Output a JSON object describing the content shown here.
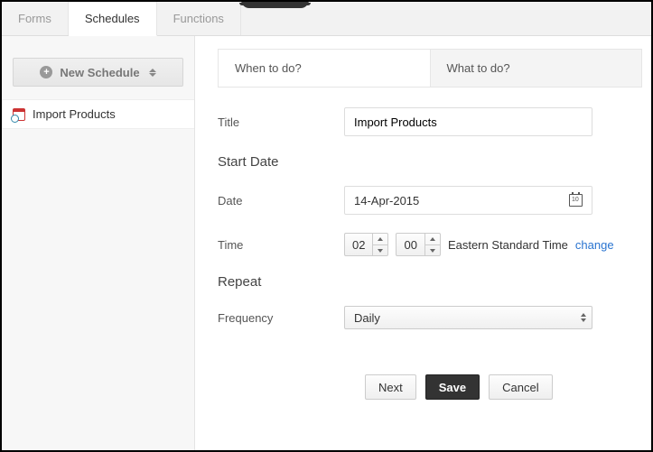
{
  "topTabs": {
    "forms": "Forms",
    "schedules": "Schedules",
    "functions": "Functions"
  },
  "sidebar": {
    "newScheduleLabel": "New Schedule",
    "items": [
      {
        "label": "Import Products"
      }
    ]
  },
  "subtabs": {
    "when": "When to do?",
    "what": "What to do?"
  },
  "form": {
    "titleLabel": "Title",
    "titleValue": "Import Products",
    "startDateHeading": "Start Date",
    "dateLabel": "Date",
    "dateValue": "14-Apr-2015",
    "timeLabel": "Time",
    "timeHour": "02",
    "timeMinute": "00",
    "timezone": "Eastern Standard Time",
    "changeLink": "change",
    "repeatHeading": "Repeat",
    "frequencyLabel": "Frequency",
    "frequencyValue": "Daily"
  },
  "buttons": {
    "next": "Next",
    "save": "Save",
    "cancel": "Cancel"
  }
}
